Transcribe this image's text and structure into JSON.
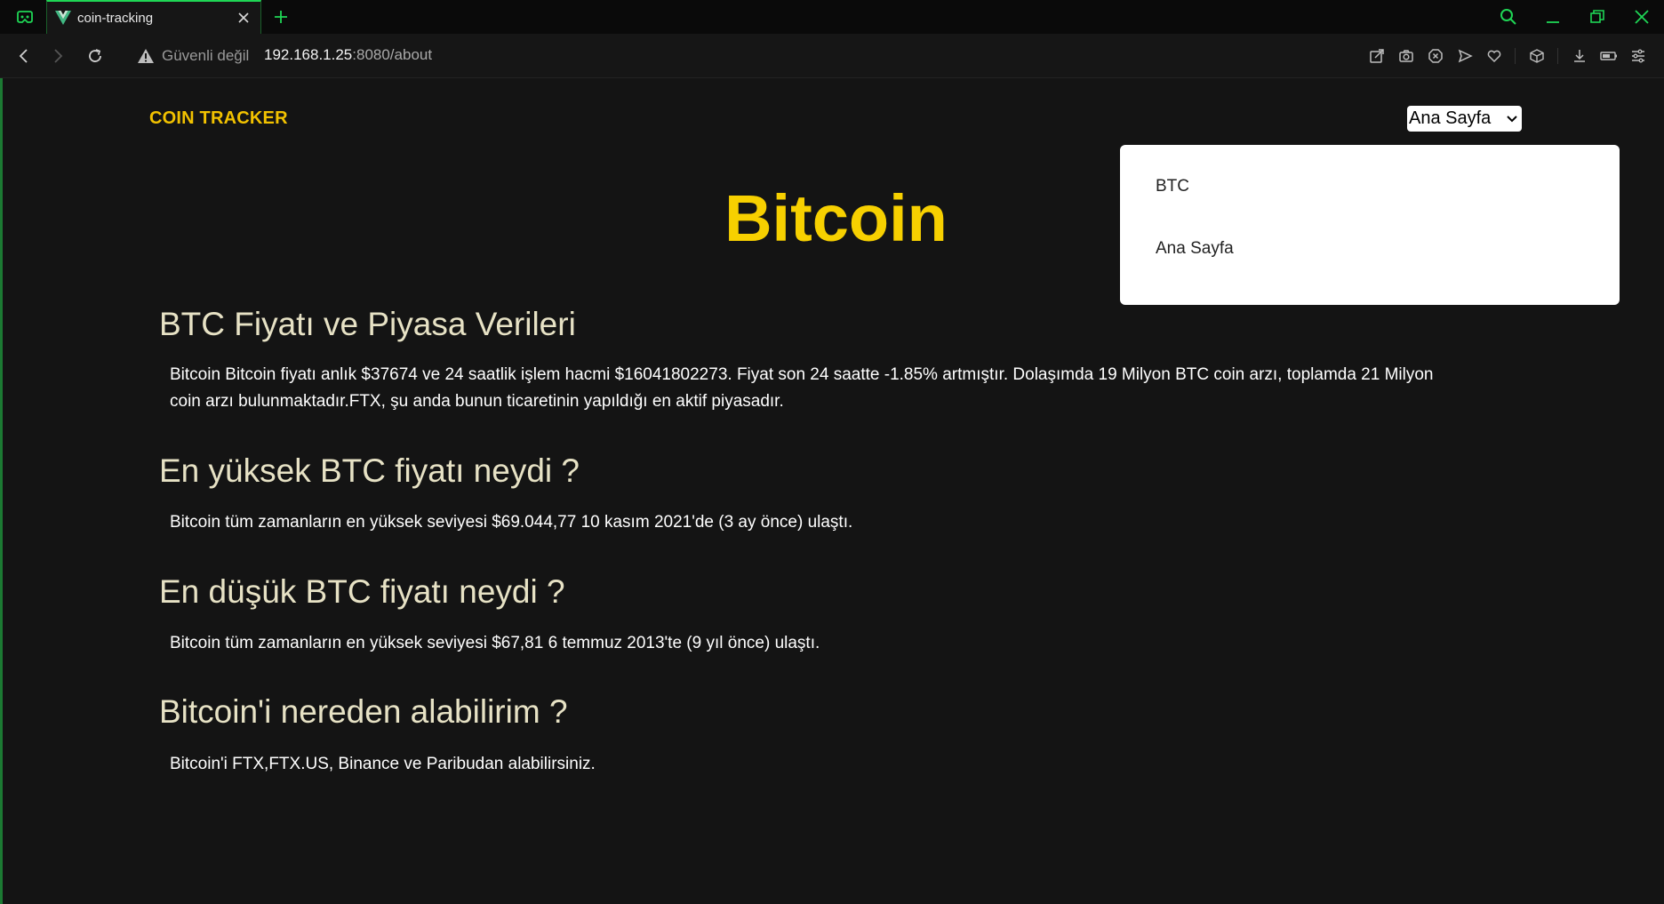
{
  "browser": {
    "tab_title": "coin-tracking",
    "security_label": "Güvenli değil",
    "url_host": "192.168.1.25",
    "url_rest": ":8080/about",
    "accent": "#1fd655"
  },
  "navbar": {
    "brand": "COIN TRACKER",
    "select_value": "Ana Sayfa",
    "dropdown_items": [
      "BTC",
      "Ana Sayfa"
    ]
  },
  "content": {
    "title": "Bitcoin",
    "sections": [
      {
        "heading": "BTC Fiyatı ve Piyasa Verileri",
        "line1": "Bitcoin Bitcoin fiyatı anlık $37674 ve 24 saatlik işlem hacmi $16041802273. Fiyat son 24 saatte -1.85% artmıştır. Dolaşımda 19 Milyon BTC coin arzı, toplamda 21 Milyon",
        "line2": "coin arzı bulunmaktadır.FTX, şu anda bunun ticaretinin yapıldığı en aktif piyasadır."
      },
      {
        "heading": "En yüksek BTC fiyatı neydi ?",
        "line1": "Bitcoin tüm zamanların en yüksek seviyesi $69.044,77 10 kasım 2021'de (3 ay önce) ulaştı."
      },
      {
        "heading": "En düşük BTC fiyatı neydi ?",
        "line1": "Bitcoin tüm zamanların en yüksek seviyesi $67,81 6 temmuz 2013'te (9 yıl önce) ulaştı."
      },
      {
        "heading": "Bitcoin'i nereden alabilirim ?",
        "line1": "Bitcoin'i FTX,FTX.US, Binance ve Paribudan alabilirsiniz."
      }
    ]
  },
  "colors": {
    "brand": "#f2c200",
    "title": "#f7d000",
    "heading": "#e7e2c5",
    "background": "#141414"
  }
}
